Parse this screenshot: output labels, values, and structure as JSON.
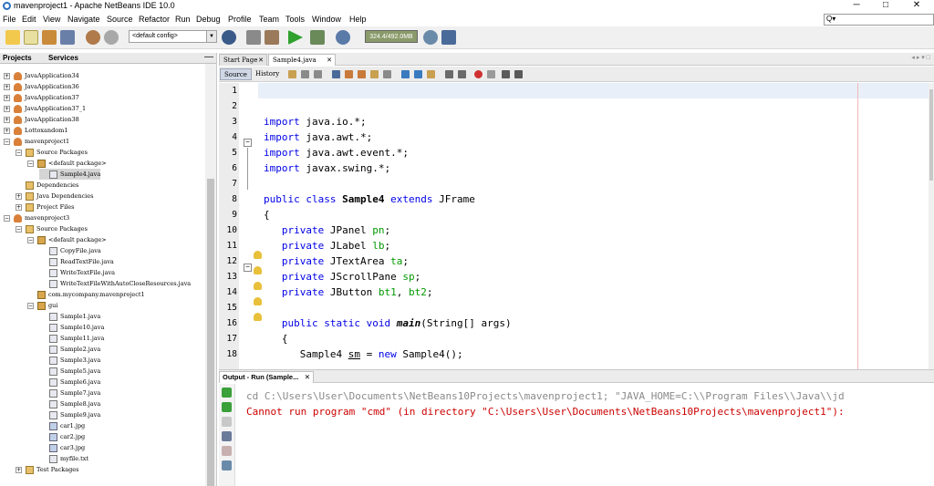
{
  "window": {
    "title": "mavenproject1 - Apache NetBeans IDE 10.0",
    "minimize": "─",
    "maximize": "□",
    "close": "✕"
  },
  "menu": [
    "File",
    "Edit",
    "View",
    "Navigate",
    "Source",
    "Refactor",
    "Run",
    "Debug",
    "Profile",
    "Team",
    "Tools",
    "Window",
    "Help"
  ],
  "search": {
    "icon": "Q▾",
    "placeholder": ""
  },
  "toolbar": {
    "config": "<default config>",
    "memory": "324.4/492.0MB",
    "icons": [
      "new-project-icon",
      "new-file-icon",
      "open-project-icon",
      "save-all-icon",
      "undo-icon",
      "redo-icon",
      "globe-icon",
      "build-icon",
      "clean-build-icon",
      "run-icon",
      "debug-icon",
      "profile-icon",
      "gc-icon"
    ]
  },
  "projects_panel": {
    "tabs": [
      "Projects",
      "Services"
    ],
    "minimize": "—",
    "tree": [
      {
        "label": "JavaApplication34",
        "level": 0,
        "type": "project",
        "exp": "+"
      },
      {
        "label": "JavaApplication36",
        "level": 0,
        "type": "project",
        "exp": "+"
      },
      {
        "label": "JavaApplication37",
        "level": 0,
        "type": "project",
        "exp": "+"
      },
      {
        "label": "JavaApplication37_1",
        "level": 0,
        "type": "project",
        "exp": "+"
      },
      {
        "label": "JavaApplication38",
        "level": 0,
        "type": "project",
        "exp": "+"
      },
      {
        "label": "Lottoxandom1",
        "level": 0,
        "type": "project",
        "exp": "+"
      },
      {
        "label": "mavenproject1",
        "level": 0,
        "type": "project",
        "exp": "−"
      },
      {
        "label": "Source Packages",
        "level": 1,
        "type": "folder",
        "exp": "−"
      },
      {
        "label": "<default package>",
        "level": 2,
        "type": "package",
        "exp": "−"
      },
      {
        "label": "Sample4.java",
        "level": 3,
        "type": "file",
        "exp": "",
        "selected": true
      },
      {
        "label": "Dependencies",
        "level": 1,
        "type": "folder",
        "exp": ""
      },
      {
        "label": "Java Dependencies",
        "level": 1,
        "type": "folder",
        "exp": "+"
      },
      {
        "label": "Project Files",
        "level": 1,
        "type": "folder",
        "exp": "+"
      },
      {
        "label": "mavenproject3",
        "level": 0,
        "type": "project",
        "exp": "−"
      },
      {
        "label": "Source Packages",
        "level": 1,
        "type": "folder",
        "exp": "−"
      },
      {
        "label": "<default package>",
        "level": 2,
        "type": "package",
        "exp": "−"
      },
      {
        "label": "CopyFile.java",
        "level": 3,
        "type": "file",
        "exp": ""
      },
      {
        "label": "ReadTextFile.java",
        "level": 3,
        "type": "file",
        "exp": ""
      },
      {
        "label": "WriteTextFile.java",
        "level": 3,
        "type": "file",
        "exp": ""
      },
      {
        "label": "WriteTextFileWithAutoCloseResources.java",
        "level": 3,
        "type": "file",
        "exp": ""
      },
      {
        "label": "com.mycompany.mavenproject1",
        "level": 2,
        "type": "package",
        "exp": ""
      },
      {
        "label": "gui",
        "level": 2,
        "type": "package",
        "exp": "−"
      },
      {
        "label": "Sample1.java",
        "level": 3,
        "type": "file",
        "exp": ""
      },
      {
        "label": "Sample10.java",
        "level": 3,
        "type": "file",
        "exp": ""
      },
      {
        "label": "Sample11.java",
        "level": 3,
        "type": "file",
        "exp": ""
      },
      {
        "label": "Sample2.java",
        "level": 3,
        "type": "file",
        "exp": ""
      },
      {
        "label": "Sample3.java",
        "level": 3,
        "type": "file",
        "exp": ""
      },
      {
        "label": "Sample5.java",
        "level": 3,
        "type": "file",
        "exp": ""
      },
      {
        "label": "Sample6.java",
        "level": 3,
        "type": "file",
        "exp": ""
      },
      {
        "label": "Sample7.java",
        "level": 3,
        "type": "file",
        "exp": ""
      },
      {
        "label": "Sample8.java",
        "level": 3,
        "type": "file",
        "exp": ""
      },
      {
        "label": "Sample9.java",
        "level": 3,
        "type": "file",
        "exp": ""
      },
      {
        "label": "car1.jpg",
        "level": 3,
        "type": "image",
        "exp": ""
      },
      {
        "label": "car2.jpg",
        "level": 3,
        "type": "image",
        "exp": ""
      },
      {
        "label": "car3.jpg",
        "level": 3,
        "type": "image",
        "exp": ""
      },
      {
        "label": "myfile.txt",
        "level": 3,
        "type": "file",
        "exp": ""
      },
      {
        "label": "Test Packages",
        "level": 1,
        "type": "folder",
        "exp": "+"
      }
    ]
  },
  "editor": {
    "tabs": [
      {
        "label": "Start Page",
        "active": false
      },
      {
        "label": "Sample4.java",
        "active": true
      }
    ],
    "tab_close": "✕",
    "nav": "◂ ▸ ▾ □",
    "modes": [
      "Source",
      "History"
    ],
    "lines": [
      {
        "n": "1",
        "code": ""
      },
      {
        "n": "2",
        "code": ""
      },
      {
        "n": "3",
        "code": "import java.io.*;"
      },
      {
        "n": "4",
        "code": "import java.awt.*;"
      },
      {
        "n": "5",
        "code": "import java.awt.event.*;"
      },
      {
        "n": "6",
        "code": "import javax.swing.*;"
      },
      {
        "n": "7",
        "code": ""
      },
      {
        "n": "8",
        "code": "public class Sample4 extends JFrame"
      },
      {
        "n": "9",
        "code": "{"
      },
      {
        "n": "10",
        "code": "   private JPanel pn;"
      },
      {
        "n": "11",
        "code": "   private JLabel lb;"
      },
      {
        "n": "12",
        "code": "   private JTextArea ta;"
      },
      {
        "n": "13",
        "code": "   private JScrollPane sp;"
      },
      {
        "n": "14",
        "code": "   private JButton bt1, bt2;"
      },
      {
        "n": "15",
        "code": ""
      },
      {
        "n": "16",
        "code": "   public static void main(String[] args)"
      },
      {
        "n": "17",
        "code": "   {"
      },
      {
        "n": "18",
        "code": "      Sample4 sm = new Sample4();"
      }
    ]
  },
  "output": {
    "tab": "Output - Run (Sample...",
    "close": "✕",
    "lines": [
      {
        "kind": "cmd",
        "text": "cd C:\\Users\\User\\Documents\\NetBeans10Projects\\mavenproject1; \"JAVA_HOME=C:\\\\Program Files\\\\Java\\\\jd"
      },
      {
        "kind": "err",
        "text": "Cannot run program \"cmd\" (in directory \"C:\\Users\\User\\Documents\\NetBeans10Projects\\mavenproject1\"):"
      }
    ]
  },
  "colors": {
    "keyword": "#0000e6",
    "field": "#009900",
    "error": "#cc0000"
  }
}
